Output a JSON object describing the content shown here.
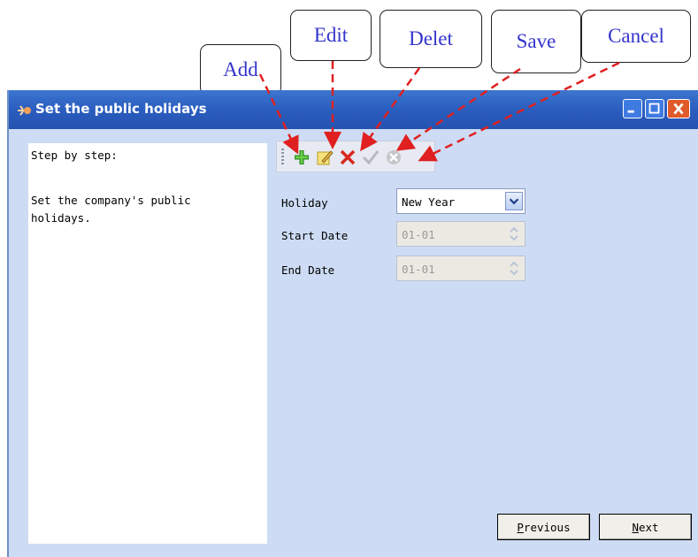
{
  "callouts": {
    "add": "Add",
    "edit": "Edit",
    "delete": "Delet",
    "save": "Save",
    "cancel": "Cancel"
  },
  "window": {
    "title": "Set the public holidays"
  },
  "left_panel": {
    "heading": "Step by step:",
    "description": "Set the company's public holidays."
  },
  "toolbar": {
    "icons": [
      "add-icon",
      "edit-icon",
      "delete-icon",
      "save-icon",
      "cancel-icon"
    ]
  },
  "form": {
    "holiday_label": "Holiday",
    "holiday_value": "New Year",
    "start_date_label": "Start Date",
    "start_date_value": "01-01",
    "end_date_label": "End Date",
    "end_date_value": "01-01"
  },
  "buttons": {
    "previous_first": "P",
    "previous_rest": "revious",
    "next_first": "N",
    "next_rest": "ext"
  },
  "colors": {
    "callout_text": "#3333cc",
    "arrow": "#e02020",
    "window_bg": "#cddcf4",
    "titlebar": "#2a5dbf"
  }
}
